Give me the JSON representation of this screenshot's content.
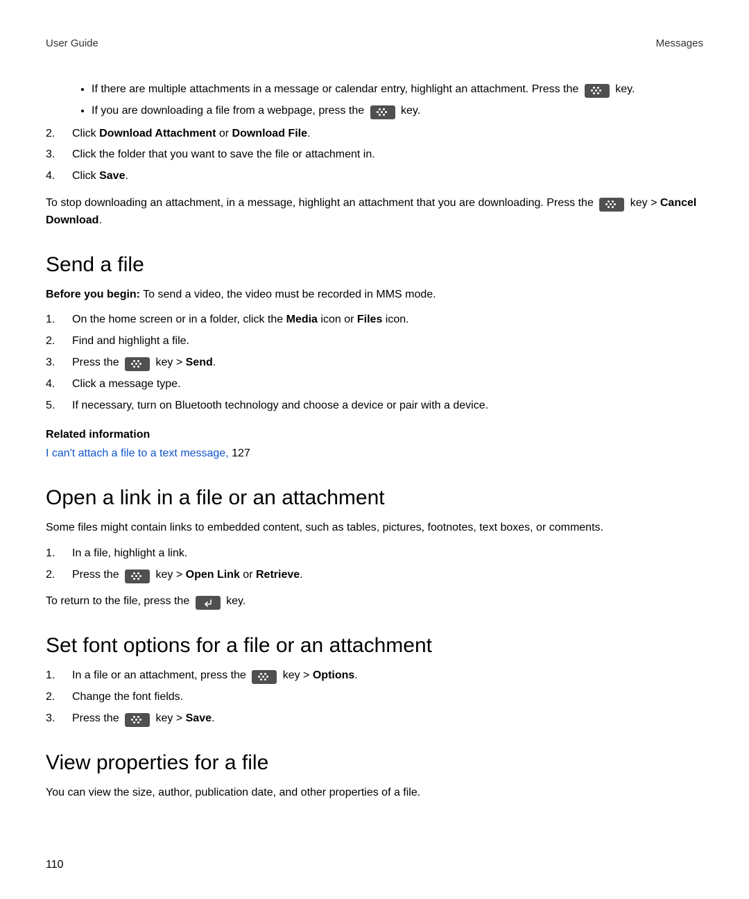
{
  "header": {
    "left": "User Guide",
    "right": "Messages"
  },
  "intro_bullets": {
    "b1_a": "If there are multiple attachments in a message or calendar entry, highlight an attachment. Press the ",
    "b1_b": " key.",
    "b2_a": "If you are downloading a file from a webpage, press the ",
    "b2_b": " key."
  },
  "intro_steps": {
    "s2_num": "2.",
    "s2_a": "Click ",
    "s2_bold1": "Download Attachment",
    "s2_mid": " or ",
    "s2_bold2": "Download File",
    "s2_end": ".",
    "s3_num": "3.",
    "s3": "Click the folder that you want to save the file or attachment in.",
    "s4_num": "4.",
    "s4_a": "Click ",
    "s4_bold": "Save",
    "s4_end": "."
  },
  "stop_dl": {
    "a": "To stop downloading an attachment, in a message, highlight an attachment that you are downloading. Press the ",
    "b": " key > ",
    "bold": "Cancel Download",
    "end": "."
  },
  "send_file": {
    "heading": "Send a file",
    "before_label": "Before you begin:",
    "before_text": " To send a video, the video must be recorded in MMS mode.",
    "s1_num": "1.",
    "s1_a": "On the home screen or in a folder, click the ",
    "s1_b1": "Media",
    "s1_mid": " icon or ",
    "s1_b2": "Files",
    "s1_end": " icon.",
    "s2_num": "2.",
    "s2": "Find and highlight a file.",
    "s3_num": "3.",
    "s3_a": "Press the ",
    "s3_b": " key > ",
    "s3_bold": "Send",
    "s3_end": ".",
    "s4_num": "4.",
    "s4": "Click a message type.",
    "s5_num": "5.",
    "s5": "If necessary, turn on Bluetooth technology and choose a device or pair with a device."
  },
  "related": {
    "heading": "Related information",
    "link_text": "I can't attach a file to a text message, ",
    "page": "127"
  },
  "open_link": {
    "heading": "Open a link in a file or an attachment",
    "intro": "Some files might contain links to embedded content, such as tables, pictures, footnotes, text boxes, or comments.",
    "s1_num": "1.",
    "s1": "In a file, highlight a link.",
    "s2_num": "2.",
    "s2_a": "Press the ",
    "s2_b": " key > ",
    "s2_bold1": "Open Link",
    "s2_mid": " or ",
    "s2_bold2": "Retrieve",
    "s2_end": ".",
    "ret_a": "To return to the file, press the ",
    "ret_b": " key."
  },
  "font_opts": {
    "heading": "Set font options for a file or an attachment",
    "s1_num": "1.",
    "s1_a": "In a file or an attachment, press the ",
    "s1_b": " key > ",
    "s1_bold": "Options",
    "s1_end": ".",
    "s2_num": "2.",
    "s2": "Change the font fields.",
    "s3_num": "3.",
    "s3_a": "Press the ",
    "s3_b": " key > ",
    "s3_bold": "Save",
    "s3_end": "."
  },
  "view_props": {
    "heading": "View properties for a file",
    "intro": "You can view the size, author, publication date, and other properties of a file."
  },
  "page_number": "110"
}
